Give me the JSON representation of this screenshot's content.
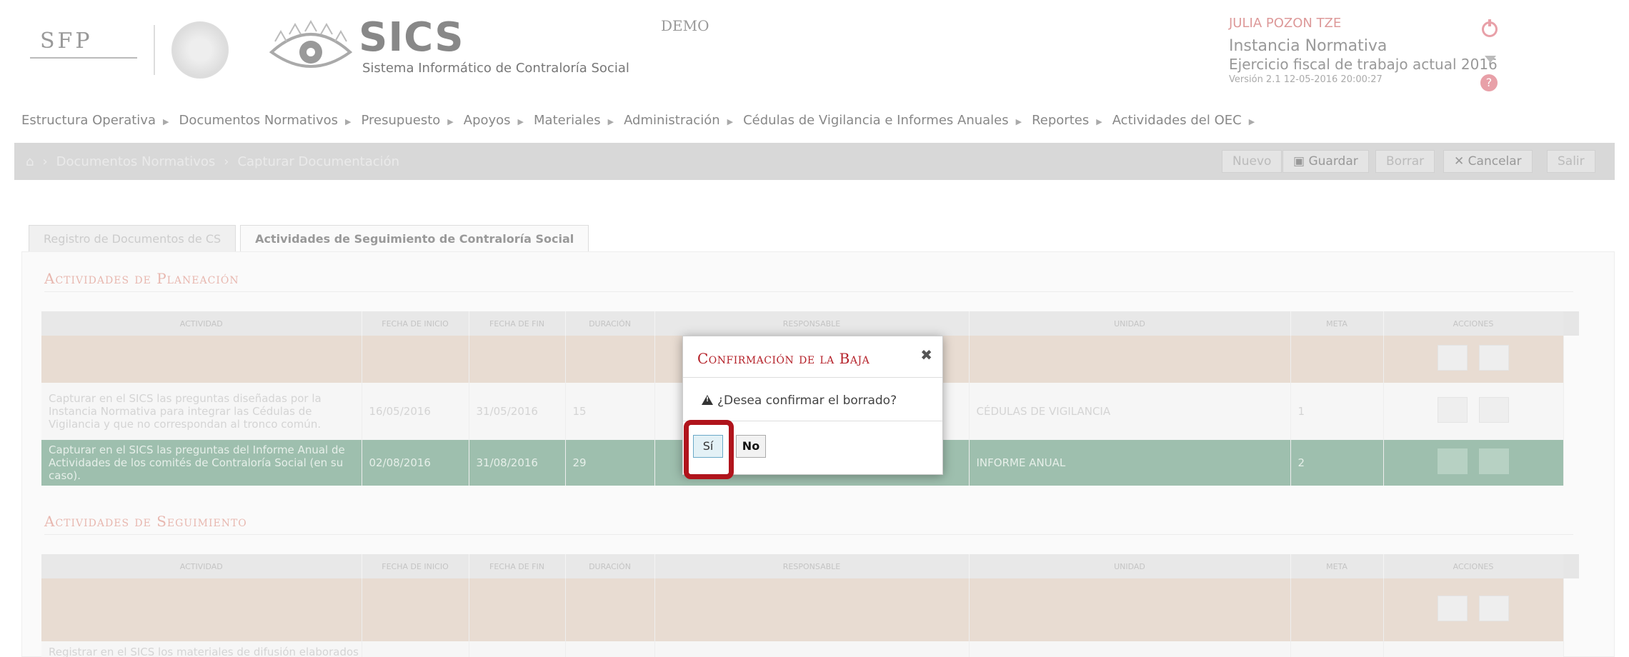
{
  "header": {
    "sfp_logo": "SFP",
    "brand_title": "SICS",
    "brand_subtitle": "Sistema Informático de Contraloría Social",
    "environment": "DEMO",
    "user_name": "JULIA POZON TZE",
    "user_role": "Instancia Normativa",
    "fiscal_year": "Ejercicio fiscal de trabajo actual 2016",
    "version": "Versión 2.1    12-05-2016 20:00:27"
  },
  "nav": {
    "items": [
      "Estructura Operativa",
      "Documentos Normativos",
      "Presupuesto",
      "Apoyos",
      "Materiales",
      "Administración",
      "Cédulas de Vigilancia e Informes Anuales",
      "Reportes",
      "Actividades del OEC"
    ]
  },
  "breadcrumb": {
    "items": [
      "Documentos Normativos",
      "Capturar Documentación"
    ]
  },
  "toolbar": {
    "nuevo": "Nuevo",
    "guardar": "Guardar",
    "borrar": "Borrar",
    "cancelar": "Cancelar",
    "salir": "Salir"
  },
  "tabs": [
    {
      "label": "Registro de Documentos de CS"
    },
    {
      "label": "Actividades de Seguimiento de Contraloría Social"
    }
  ],
  "sections": {
    "planeacion_title": "Actividades de Planeación",
    "seguimiento_title": "Actividades de Seguimiento"
  },
  "table_headers": [
    "Actividad",
    "Fecha de inicio",
    "Fecha de fin",
    "Duración",
    "Responsable",
    "Unidad",
    "Meta",
    "Acciones"
  ],
  "planeacion_rows": [
    {
      "actividad": "",
      "inicio": "",
      "fin": "",
      "duracion": "",
      "responsable": "",
      "unidad": "",
      "meta": ""
    },
    {
      "actividad": "Capturar en el SICS las preguntas diseñadas por la Instancia Normativa para integrar las Cédulas de Vigilancia y que no correspondan al tronco común.",
      "inicio": "16/05/2016",
      "fin": "31/05/2016",
      "duracion": "15",
      "responsable": "",
      "unidad": "CÉDULAS DE VIGILANCIA",
      "meta": "1"
    },
    {
      "actividad": "Capturar en el SICS las preguntas del Informe Anual de Actividades de los comités de Contraloría Social (en su caso).",
      "inicio": "02/08/2016",
      "fin": "31/08/2016",
      "duracion": "29",
      "responsable": "",
      "unidad": "INFORME ANUAL",
      "meta": "2"
    }
  ],
  "seguimiento_rows": [
    {
      "actividad": "",
      "inicio": "",
      "fin": "",
      "duracion": "",
      "responsable": "",
      "unidad": "",
      "meta": ""
    },
    {
      "actividad": "Registrar en el SICS los materiales de difusión elaborados",
      "inicio": "",
      "fin": "",
      "duracion": "",
      "responsable": "",
      "unidad": "",
      "meta": ""
    }
  ],
  "dialog": {
    "title": "Confirmación de la Baja",
    "message": "¿Desea confirmar el borrado?",
    "yes_label": "Sí",
    "no_label": "No"
  },
  "colors": {
    "dialog_title": "#b5222a",
    "highlight_border": "#b0141c",
    "selected_row": "#9ebfae"
  }
}
